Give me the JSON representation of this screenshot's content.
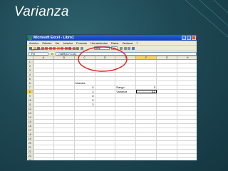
{
  "slide": {
    "title": "Varianza"
  },
  "window": {
    "title": "Microsoft Excel - Libro1"
  },
  "menu": [
    "Archivo",
    "Edición",
    "Ver",
    "Insertar",
    "Formato",
    "Herramientas",
    "Datos",
    "Ventana",
    "?"
  ],
  "toolbar": {
    "font": "Arial",
    "size": "10"
  },
  "formula_bar": {
    "name_box": "F8",
    "fx": "fx",
    "formula": "=VAR(C7:C11)"
  },
  "columns": [
    "",
    "A",
    "B",
    "C",
    "D",
    "E",
    "F",
    "G",
    "H"
  ],
  "selected_column": "F",
  "selected_row": 8,
  "rows": [
    {
      "n": "1",
      "cells": [
        "",
        "",
        "",
        "",
        "",
        "",
        "",
        ""
      ]
    },
    {
      "n": "2",
      "cells": [
        "",
        "",
        "",
        "",
        "",
        "",
        "",
        ""
      ]
    },
    {
      "n": "3",
      "cells": [
        "",
        "",
        "",
        "",
        "",
        "",
        "",
        ""
      ]
    },
    {
      "n": "4",
      "cells": [
        "",
        "",
        "",
        "",
        "",
        "",
        "",
        ""
      ]
    },
    {
      "n": "5",
      "cells": [
        "",
        "",
        "",
        "",
        "",
        "",
        "",
        ""
      ]
    },
    {
      "n": "6",
      "cells": [
        "",
        "",
        "Muestra",
        "",
        "",
        "",
        "",
        ""
      ]
    },
    {
      "n": "7",
      "cells": [
        "",
        "",
        "5",
        "",
        "Rango",
        "5",
        "",
        ""
      ]
    },
    {
      "n": "8",
      "cells": [
        "",
        "",
        "3",
        "",
        "Varianza",
        "4,2",
        "",
        ""
      ]
    },
    {
      "n": "9",
      "cells": [
        "",
        "",
        "8",
        "",
        "",
        "",
        "",
        ""
      ]
    },
    {
      "n": "10",
      "cells": [
        "",
        "",
        "5",
        "",
        "",
        "",
        "",
        ""
      ]
    },
    {
      "n": "11",
      "cells": [
        "",
        "",
        "3",
        "",
        "",
        "",
        "",
        ""
      ]
    },
    {
      "n": "12",
      "cells": [
        "",
        "",
        "",
        "",
        "",
        "",
        "",
        ""
      ]
    },
    {
      "n": "13",
      "cells": [
        "",
        "",
        "",
        "",
        "",
        "",
        "",
        ""
      ]
    },
    {
      "n": "14",
      "cells": [
        "",
        "",
        "",
        "",
        "",
        "",
        "",
        ""
      ]
    },
    {
      "n": "15",
      "cells": [
        "",
        "",
        "",
        "",
        "",
        "",
        "",
        ""
      ]
    },
    {
      "n": "16",
      "cells": [
        "",
        "",
        "",
        "",
        "",
        "",
        "",
        ""
      ]
    },
    {
      "n": "17",
      "cells": [
        "",
        "",
        "",
        "",
        "",
        "",
        "",
        ""
      ]
    },
    {
      "n": "18",
      "cells": [
        "",
        "",
        "",
        "",
        "",
        "",
        "",
        ""
      ]
    },
    {
      "n": "19",
      "cells": [
        "",
        "",
        "",
        "",
        "",
        "",
        "",
        ""
      ]
    },
    {
      "n": "20",
      "cells": [
        "",
        "",
        "",
        "",
        "",
        "",
        "",
        ""
      ]
    },
    {
      "n": "21",
      "cells": [
        "",
        "",
        "",
        "",
        "",
        "",
        "",
        ""
      ]
    },
    {
      "n": "22",
      "cells": [
        "",
        "",
        "",
        "",
        "",
        "",
        "",
        ""
      ]
    },
    {
      "n": "23",
      "cells": [
        "",
        "",
        "",
        "",
        "",
        "",
        "",
        ""
      ]
    },
    {
      "n": "24",
      "cells": [
        "",
        "",
        "",
        "",
        "",
        "",
        "",
        ""
      ]
    }
  ],
  "colors": {
    "background": "#1f4a55",
    "annotation": "#e0201a",
    "titlebar": "#0a3fb6",
    "selection": "#ffcf6b"
  }
}
